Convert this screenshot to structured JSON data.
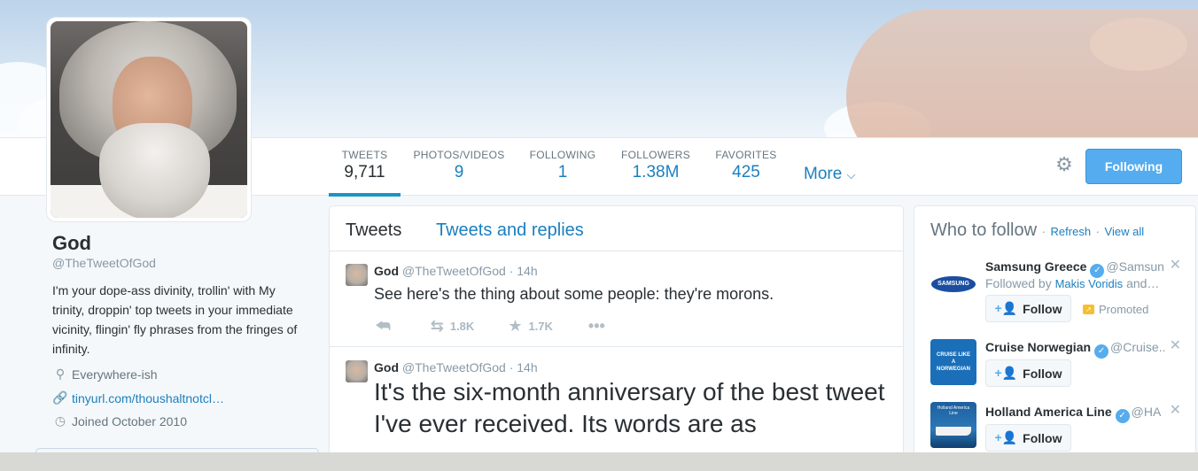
{
  "profile": {
    "name": "God",
    "handle": "@TheTweetOfGod",
    "bio": "I'm your dope-ass divinity, trollin' with My trinity, droppin' top tweets in your immediate vicinity, flingin' fly phrases from the fringes of infinity.",
    "location": "Everywhere-ish",
    "url": "tinyurl.com/thoushaltnotcl…",
    "joined": "Joined October 2010"
  },
  "stats": [
    {
      "label": "TWEETS",
      "value": "9,711"
    },
    {
      "label": "PHOTOS/VIDEOS",
      "value": "9"
    },
    {
      "label": "FOLLOWING",
      "value": "1"
    },
    {
      "label": "FOLLOWERS",
      "value": "1.38M"
    },
    {
      "label": "FAVORITES",
      "value": "425"
    }
  ],
  "nav": {
    "more_label": "More",
    "following_button": "Following"
  },
  "timeline": {
    "tabs": [
      "Tweets",
      "Tweets and replies"
    ],
    "tweets": [
      {
        "name": "God",
        "handle": "@TheTweetOfGod",
        "time": "· 14h",
        "text": "See here's the thing about some people: they're morons.",
        "retweets": "1.8K",
        "favorites": "1.7K"
      },
      {
        "name": "God",
        "handle": "@TheTweetOfGod",
        "time": "· 14h",
        "text": "It's the six-month anniversary of the best tweet I've ever received. Its words are as"
      }
    ]
  },
  "who_to_follow": {
    "title": "Who to follow",
    "refresh": "Refresh",
    "view_all": "View all",
    "separator": "·",
    "follow_label": "Follow",
    "suggestions": [
      {
        "name": "Samsung Greece",
        "handle": "@Samsun.",
        "followed_by": "Followed by",
        "followed_name": "Makis Voridis",
        "followed_suffix": "and…",
        "promoted": "Promoted",
        "logo_text": "SAMSUNG"
      },
      {
        "name": "Cruise Norwegian",
        "handle": "@Cruise..",
        "logo_text": "CRUISE LIKE A NORWEGIAN"
      },
      {
        "name": "Holland America Line",
        "handle": "@HA",
        "logo_text": "Holland America Line"
      }
    ]
  },
  "colors": {
    "link": "#1b7fbf",
    "accent": "#55acee",
    "text": "#292f33",
    "muted": "#8899a6"
  }
}
